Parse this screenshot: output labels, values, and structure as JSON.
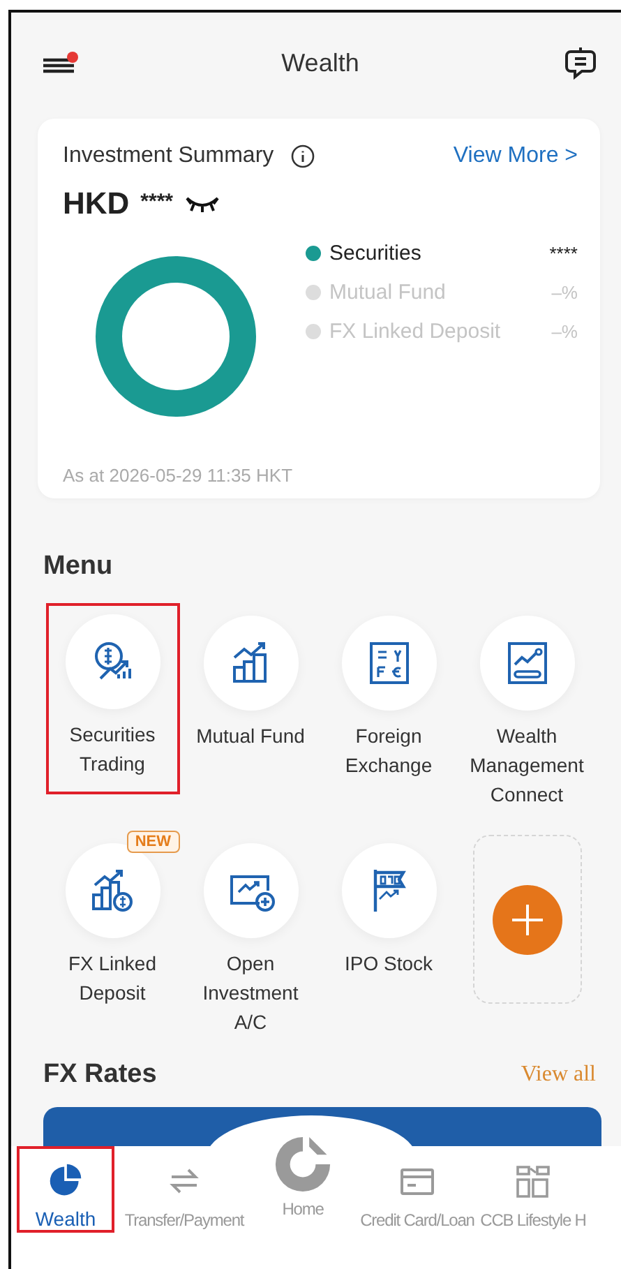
{
  "header": {
    "title": "Wealth",
    "menu_notification": true
  },
  "summary": {
    "title": "Investment Summary",
    "link": "View More >",
    "currency": "HKD",
    "amount": "****",
    "legend": [
      {
        "label": "Securities",
        "value": "****",
        "color": "#1a9a92",
        "active": true
      },
      {
        "label": "Mutual Fund",
        "value": "–%",
        "color": "#dddddd",
        "active": false
      },
      {
        "label": "FX Linked Deposit",
        "value": "–%",
        "color": "#dddddd",
        "active": false
      }
    ],
    "as_at": "As at 2026-05-29 11:35 HKT"
  },
  "menu": {
    "title": "Menu",
    "items": [
      {
        "kind": "shortcut",
        "label": "Securities Trading",
        "highlighted": true
      },
      {
        "kind": "shortcut",
        "label": "Mutual Fund",
        "highlighted": false
      },
      {
        "kind": "shortcut",
        "label": "Foreign Exchange",
        "highlighted": false
      },
      {
        "kind": "shortcut",
        "label": "Wealth Management Connect",
        "highlighted": false
      },
      {
        "kind": "shortcut",
        "label": "FX Linked Deposit",
        "badge": "NEW",
        "highlighted": false
      },
      {
        "kind": "shortcut",
        "label": "Open Investment A/C",
        "highlighted": false
      },
      {
        "kind": "shortcut",
        "label": "IPO Stock",
        "highlighted": false
      },
      {
        "kind": "add",
        "highlighted": false
      }
    ]
  },
  "fx_rates": {
    "title": "FX Rates",
    "link": "View all"
  },
  "nav": [
    {
      "label": "Wealth",
      "selected": true,
      "highlighted": true
    },
    {
      "label": "Transfer/Payment",
      "selected": false,
      "highlighted": false
    },
    {
      "label": "Home",
      "selected": false,
      "highlighted": false
    },
    {
      "label": "Credit Card/Loan",
      "selected": false,
      "highlighted": false
    },
    {
      "label": "CCB Lifestyle H",
      "selected": false,
      "highlighted": false
    }
  ]
}
